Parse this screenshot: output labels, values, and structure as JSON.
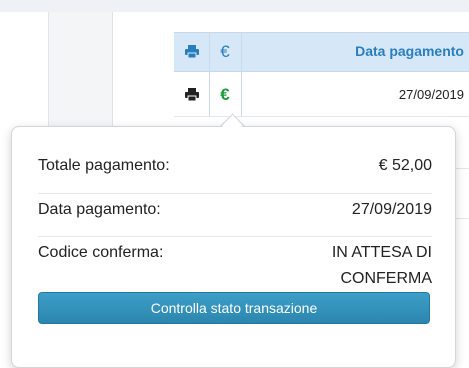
{
  "table": {
    "header": {
      "print_icon": "printer-icon",
      "euro_symbol": "€",
      "date_column": "Data pagamento"
    },
    "rows": [
      {
        "print_icon": "printer-icon",
        "euro_symbol": "€",
        "date": "27/09/2019"
      }
    ]
  },
  "popover": {
    "total_label": "Totale pagamento:",
    "total_value": "€ 52,00",
    "date_label": "Data pagamento:",
    "date_value": "27/09/2019",
    "code_label": "Codice conferma:",
    "code_value_line1": "IN ATTESA DI",
    "code_value_line2": "CONFERMA",
    "check_button": "Controlla stato transazione"
  },
  "colors": {
    "header_bg": "#d6e8f7",
    "header_text": "#2a7ebf",
    "euro_row": "#1f9a3b",
    "button": "#2b86af"
  }
}
